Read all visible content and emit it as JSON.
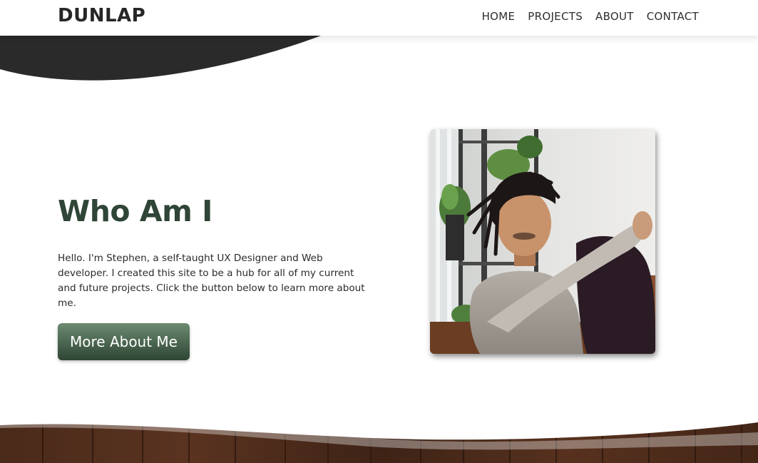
{
  "brand": {
    "logo": "DUNLAP"
  },
  "nav": {
    "items": [
      {
        "label": "HOME"
      },
      {
        "label": "PROJECTS"
      },
      {
        "label": "ABOUT"
      },
      {
        "label": "CONTACT"
      }
    ]
  },
  "hero": {
    "title": "Who Am I",
    "description": "Hello. I'm Stephen, a self-taught UX Designer and Web developer. I created this site to be a hub for all of my current and future projects. Click the button below to learn more about me.",
    "button_label": "More About Me"
  },
  "colors": {
    "title_green": "#2f4537",
    "button_gradient": [
      "#6e8a72",
      "#2f4535"
    ],
    "wave_dark": "#2a2a2a",
    "wood_brown": "#4a2a1a"
  },
  "icons": {
    "profile_photo": "portrait-photo"
  }
}
